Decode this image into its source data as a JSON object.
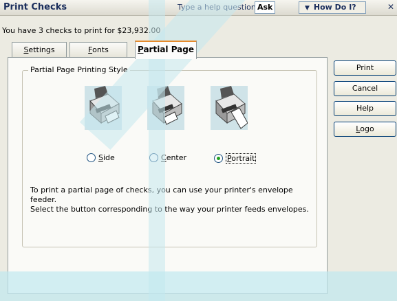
{
  "window": {
    "title": "Print Checks",
    "close_icon": "close-icon"
  },
  "help": {
    "question_label": "Type a help question",
    "ask_label": "Ask",
    "how_do_label": "How Do I?"
  },
  "summary": "You have 3 checks to print for $23,932.00",
  "tabs": [
    {
      "label": "Settings",
      "mnemonic": "S",
      "rest": "ettings"
    },
    {
      "label": "Fonts",
      "mnemonic": "F",
      "rest": "onts"
    },
    {
      "label": "Partial Page",
      "mnemonic": "P",
      "rest": "artial Page",
      "selected": true
    }
  ],
  "group": {
    "legend": "Partial Page Printing Style",
    "options": [
      {
        "label": "Side",
        "mnemonic": "S",
        "rest": "ide",
        "checked": false
      },
      {
        "label": "Center",
        "mnemonic": "C",
        "rest": "enter",
        "checked": false
      },
      {
        "label": "Portrait",
        "mnemonic": "P",
        "rest": "ortrait",
        "checked": true
      }
    ],
    "instructions_line1": "To print a partial page of checks,  you can use your printer's envelope feeder.",
    "instructions_line2": "Select the button corresponding to the way your printer feeds envelopes."
  },
  "buttons": {
    "print": {
      "label": "Print"
    },
    "cancel": {
      "label": "Cancel"
    },
    "help": {
      "label": "Help"
    },
    "logo": {
      "mnemonic": "L",
      "rest": "ogo",
      "label": "Logo"
    }
  },
  "colors": {
    "title_text": "#1b2e5c",
    "radio_checked": "#21a121",
    "tab_highlight": "#e68b2c"
  }
}
